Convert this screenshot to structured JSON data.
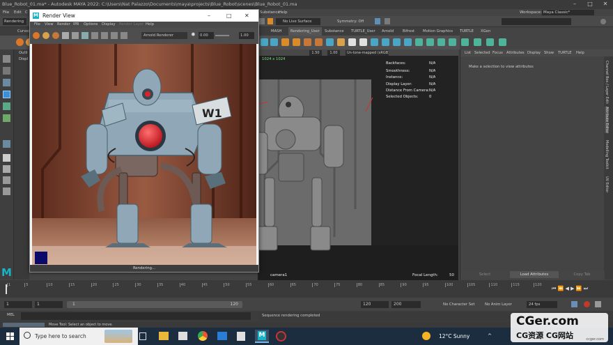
{
  "title": "Blue_Robot_01.ma* - Autodesk MAYA 2022: C:\\Users\\Nat Palazzo\\Documents\\maya\\projects\\Blue_Robot\\scenes\\Blue_Robot_01.ma",
  "menubar": {
    "left": [
      "File",
      "Edit",
      "C"
    ],
    "right": [
      "Substance",
      "Help"
    ],
    "workspace_label": "Workspace:",
    "workspace_value": "Maya Classic*"
  },
  "status": {
    "mode": "Rendering",
    "live_surface": "No Live Surface",
    "symmetry": "Symmetry: Off"
  },
  "shelf_tabs": [
    "Curves",
    "MASH",
    "Rendering_User",
    "Substance",
    "TURTLE_User",
    "Arnold",
    "Bifrost",
    "Motion Graphics",
    "TURTLE",
    "XGen"
  ],
  "outliner": {
    "label": "Outli",
    "display": "Displ"
  },
  "render_view": {
    "title": "Render View",
    "menu": [
      "File",
      "View",
      "Render",
      "IPR",
      "Options",
      "Display",
      "Render Layer",
      "Help"
    ],
    "renderer": "Arnold Renderer",
    "exposure": "0.00",
    "gamma": "1.00",
    "status": "Rendering...",
    "badge": "W1",
    "colors": {
      "wall": "#8a4a36",
      "floor": "#b07b62",
      "robot_body": "#8fa7b6",
      "eye": "#d9222a",
      "panel": "#2f2f2f"
    }
  },
  "viewport": {
    "resolution": "1024 x 1024",
    "camera": "camera1",
    "focal_label": "Focal Length:",
    "focal_value": "50",
    "toolbar_vals": [
      "1.50",
      "1.00"
    ],
    "color_mgmt": "Un-tone-mapped (sRGB)",
    "hud": [
      {
        "label": "Backfaces:",
        "value": "N/A"
      },
      {
        "label": "Smoothness:",
        "value": "N/A"
      },
      {
        "label": "Instance:",
        "value": "N/A"
      },
      {
        "label": "Display Layer:",
        "value": "N/A"
      },
      {
        "label": "Distance From Camera:",
        "value": "N/A"
      },
      {
        "label": "Selected Objects:",
        "value": "0"
      }
    ]
  },
  "attribute_editor": {
    "tabs": [
      "List",
      "Selected",
      "Focus",
      "Attributes",
      "Display",
      "Show",
      "TURTLE",
      "Help"
    ],
    "message": "Make a selection to view attributes",
    "buttons": [
      "Select",
      "Load Attributes",
      "Copy Tab"
    ],
    "side_tabs": [
      "Attribute Editor",
      "Modelling Toolkit",
      "UV Editor",
      "Channel Box / Layer Editor"
    ]
  },
  "timeline": {
    "ticks": [
      "1",
      "5",
      "10",
      "15",
      "20",
      "25",
      "30",
      "35",
      "40",
      "45",
      "50",
      "55",
      "60",
      "65",
      "70",
      "75",
      "80",
      "85",
      "90",
      "95",
      "100",
      "105",
      "110",
      "115",
      "120"
    ],
    "current_frame": "1"
  },
  "range": {
    "start": "1",
    "range_start": "1",
    "slider_start": "1",
    "slider_end": "120",
    "end": "120",
    "anim_end": "200",
    "character_set": "No Character Set",
    "anim_layer": "No Anim Layer",
    "fps": "24 fps"
  },
  "mel": {
    "label": "MEL",
    "result": "Sequence rendering completed"
  },
  "helpline": "Move Tool: Select an object to move.",
  "taskbar": {
    "search": "Type here to search",
    "weather": "12°C  Sunny",
    "accent": "#1c2d3f"
  },
  "watermark": {
    "line1": "CGer.com",
    "line2": "CG资源  CG网站",
    "sub": "ccger.com"
  }
}
